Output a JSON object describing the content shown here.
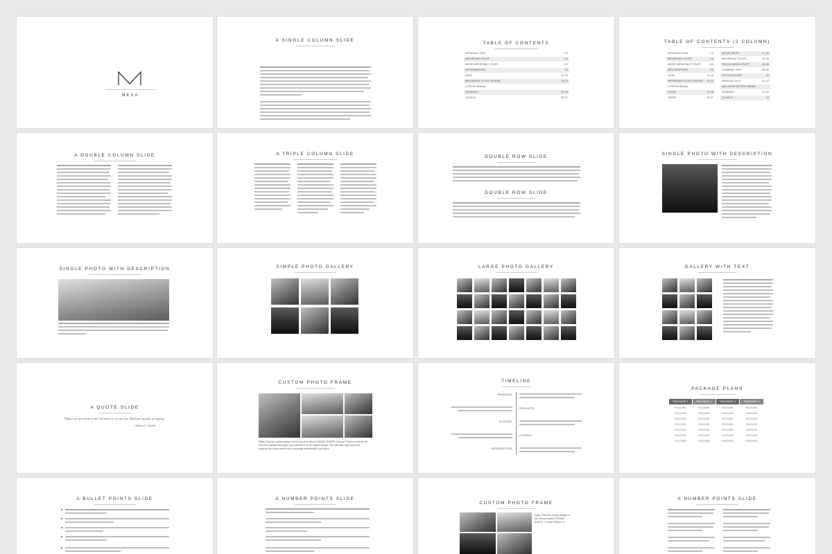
{
  "slides": {
    "mesa_cover": {
      "logo_text": "MESA"
    },
    "single_column": {
      "title": "A SINGLE COLUMN SLIDE"
    },
    "toc": {
      "title": "TABLE OF CONTENTS",
      "rows": [
        {
          "label": "INTRODUCTION",
          "page": "1-5"
        },
        {
          "label": "IMPORTANT STUFF",
          "page": "3-6"
        },
        {
          "label": "MORE IMPORTANT STUFF",
          "page": "6-9"
        },
        {
          "label": "INFOGRAPHICS",
          "page": "10"
        },
        {
          "label": "DATA",
          "page": "11-16"
        },
        {
          "label": "IMPORTANT STUFF (AGAIN)",
          "page": "16-19"
        },
        {
          "label": "COFFEE BREAK",
          "page": ""
        },
        {
          "label": "SUMMARY",
          "page": "20-26"
        },
        {
          "label": "Q AND A",
          "page": "26-27"
        }
      ]
    },
    "toc2": {
      "title": "TABLE OF CONTENTS (2 COLUMN)",
      "left_rows": [
        {
          "label": "INTRODUCTION",
          "page": "1-5"
        },
        {
          "label": "IMPORTANT STUFF",
          "page": "3-6"
        },
        {
          "label": "MORE IMPORTANT STUFF",
          "page": "6-9"
        },
        {
          "label": "INFOGRAPHICS",
          "page": "10"
        },
        {
          "label": "DATA",
          "page": "11-16"
        },
        {
          "label": "IMPORTANT STUFF (AGAIN)",
          "page": "16-19"
        },
        {
          "label": "COFFEE BREAK",
          "page": ""
        },
        {
          "label": "STUFF",
          "page": "20-26"
        },
        {
          "label": "JOKES",
          "page": "26-27"
        }
      ],
      "right_rows": [
        {
          "label": "MORE JOKES",
          "page": "27-30"
        },
        {
          "label": "IMPORTANT STUFF",
          "page": "30-33"
        },
        {
          "label": "SOCIAL MEDIA STUFF",
          "page": "33-36"
        },
        {
          "label": "COMPANY INFO",
          "page": "36-39"
        },
        {
          "label": "SPECULATIONS",
          "page": "40"
        },
        {
          "label": "SERIOUS TALK",
          "page": "41-42"
        },
        {
          "label": "ANOTHER COFFEE BREAK",
          "page": ""
        },
        {
          "label": "SUMMARY",
          "page": "43-44"
        },
        {
          "label": "Q AND A",
          "page": "44"
        }
      ]
    },
    "double_column": {
      "title": "A DOUBLE COLUMN SLIDE"
    },
    "triple_column": {
      "title": "A TRIPLE COLUMN SLIDE"
    },
    "double_row": {
      "title_top": "DOUBLE ROW SLIDE",
      "title_bottom": "DOUBLE ROW SLIDE"
    },
    "single_photo_desc_a": {
      "title": "SINGLE PHOTO WITH DESCRIPTION"
    },
    "single_photo_desc_b": {
      "title": "SINGLE PHOTO WITH DESCRIPTION"
    },
    "simple_gallery": {
      "title": "SIMPLE PHOTO GALLERY"
    },
    "large_gallery": {
      "title": "LARGE PHOTO GALLERY"
    },
    "gallery_text": {
      "title": "GALLERY WITH TEXT"
    },
    "quote": {
      "title": "A QUOTE SLIDE",
      "quote": "\"Either we are alone in the Universe or we are not. Both are equally terrifying.\"",
      "author": "- Arthur C. Clarke"
    },
    "custom_frame_a": {
      "title": "CUSTOM PHOTO FRAME",
      "caption_1": "Right Click the custom shape on the top and select FORMAT SHAPE. Choose Picture or texture fill",
      "caption_2": "from the sidebar and select your picture to fit the custom shape. You can also right click and",
      "caption_3": "ungroup the frame and fit each rectangle individually if you want."
    },
    "timeline": {
      "title": "TIMELINE",
      "items": [
        {
          "label": "FINANCING"
        },
        {
          "label": "PRODUCTS"
        },
        {
          "label": "CLOSURE"
        },
        {
          "label": "CONTENT"
        },
        {
          "label": "INTRODUCTION"
        }
      ]
    },
    "package_plans": {
      "title": "PACKAGE PLANS",
      "headers": [
        "PACKAGE 1",
        "PACKAGE 2",
        "PACKAGE 3",
        "PACKAGE 4"
      ],
      "feature_label": "FEATURE"
    },
    "bullet_points": {
      "title": "A BULLET POINTS SLIDE"
    },
    "number_points": {
      "title": "A NUMBER POINTS SLIDE"
    },
    "custom_frame_b": {
      "title": "CUSTOM PHOTO FRAME",
      "caption_1": "Right Click the custom shape on",
      "caption_2": "the left and select FORMAT",
      "caption_3": "SHAPE. Choose Picture or"
    },
    "number_points_b": {
      "title": "A NUMBER POINTS SLIDE"
    }
  }
}
